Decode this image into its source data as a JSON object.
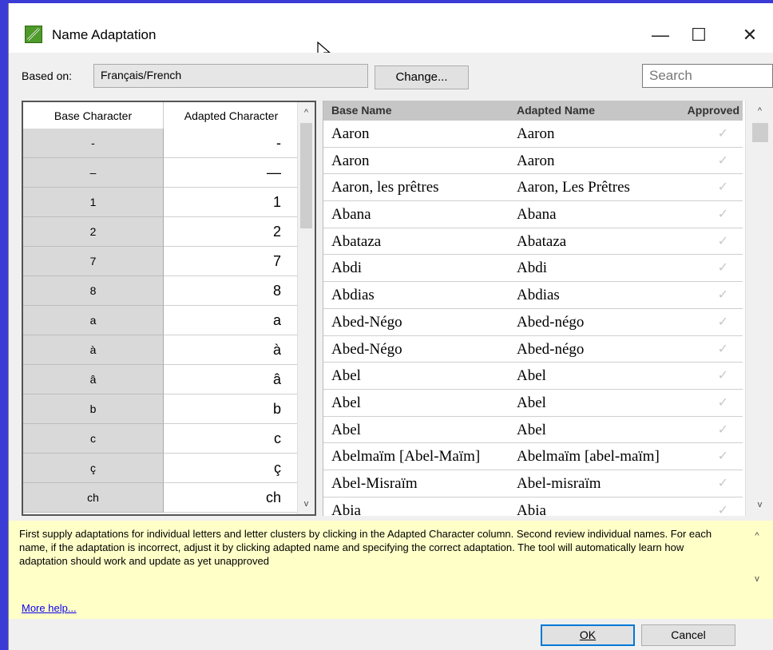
{
  "window": {
    "title": "Name Adaptation",
    "minimize": "—",
    "maximize": "☐",
    "close": "✕",
    "icon": "name-adaptation-app-icon"
  },
  "based_on": {
    "label": "Based on:",
    "value": "Français/French",
    "change_label": "Change...",
    "search_placeholder": "Search"
  },
  "char_grid": {
    "headers": [
      "Base Character",
      "Adapted Character"
    ],
    "rows": [
      {
        "base": "-",
        "adapted": "-"
      },
      {
        "base": "–",
        "adapted": "—"
      },
      {
        "base": "1",
        "adapted": "1"
      },
      {
        "base": "2",
        "adapted": "2"
      },
      {
        "base": "7",
        "adapted": "7"
      },
      {
        "base": "8",
        "adapted": "8"
      },
      {
        "base": "a",
        "adapted": "a"
      },
      {
        "base": "à",
        "adapted": "à"
      },
      {
        "base": "â",
        "adapted": "â"
      },
      {
        "base": "b",
        "adapted": "b"
      },
      {
        "base": "c",
        "adapted": "c"
      },
      {
        "base": "ç",
        "adapted": "ç"
      },
      {
        "base": "ch",
        "adapted": "ch"
      }
    ]
  },
  "names_grid": {
    "headers": [
      "Base Name",
      "Adapted Name",
      "Approved"
    ],
    "rows": [
      {
        "base": "Aaron",
        "adapted": "Aaron",
        "approved": false
      },
      {
        "base": "Aaron",
        "adapted": "Aaron",
        "approved": false
      },
      {
        "base": "Aaron, les prêtres",
        "adapted": "Aaron, Les Prêtres",
        "approved": false
      },
      {
        "base": "Abana",
        "adapted": "Abana",
        "approved": false
      },
      {
        "base": "Abataza",
        "adapted": "Abataza",
        "approved": false
      },
      {
        "base": "Abdi",
        "adapted": "Abdi",
        "approved": false
      },
      {
        "base": "Abdias",
        "adapted": "Abdias",
        "approved": false
      },
      {
        "base": "Abed-Négo",
        "adapted": "Abed-négo",
        "approved": false
      },
      {
        "base": "Abed-Négo",
        "adapted": "Abed-négo",
        "approved": false
      },
      {
        "base": "Abel",
        "adapted": "Abel",
        "approved": false
      },
      {
        "base": "Abel",
        "adapted": "Abel",
        "approved": false
      },
      {
        "base": "Abel",
        "adapted": "Abel",
        "approved": false
      },
      {
        "base": "Abelmaïm [Abel-Maïm]",
        "adapted": "Abelmaïm [abel-maïm]",
        "approved": false
      },
      {
        "base": "Abel-Misraïm",
        "adapted": "Abel-misraïm",
        "approved": false
      },
      {
        "base": "Abia",
        "adapted": "Abia",
        "approved": false
      }
    ]
  },
  "help": {
    "text": "First supply adaptations for individual letters and letter clusters by clicking in the Adapted Character column. Second review individual names. For each name, if the adaptation is incorrect, adjust it by clicking adapted name and specifying the correct adaptation. The tool will automatically learn how adaptation should work and update as yet unapproved",
    "more_help": "More help..."
  },
  "buttons": {
    "ok": "OK",
    "cancel": "Cancel"
  },
  "icons": {
    "check": "✓",
    "scroll_up": "▲",
    "scroll_down": "▼"
  }
}
